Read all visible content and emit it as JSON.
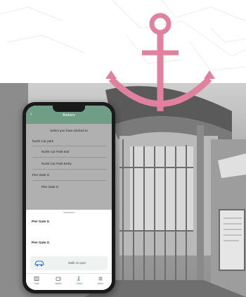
{
  "app": {
    "header_title": "Berkers",
    "subtitle": "Select you have docked to",
    "locations": [
      {
        "label": "North Car park",
        "kind": "section"
      },
      {
        "label": "North Car Park Exit",
        "kind": "sub"
      },
      {
        "label": "North Car Park Entry",
        "kind": "sub"
      },
      {
        "label": "Pier Gate G",
        "kind": "section"
      },
      {
        "label": "Pier Gate G",
        "kind": "sub"
      }
    ],
    "sheet": {
      "items": [
        "Pier Gate G",
        "Pier Gate G"
      ],
      "walk_label": "Walk on open"
    },
    "tabs": [
      {
        "label": "Gate",
        "icon": "gate-icon",
        "active": false
      },
      {
        "label": "Wallet",
        "icon": "wallet-icon",
        "active": false
      },
      {
        "label": "Direct",
        "icon": "directions-icon",
        "active": true
      },
      {
        "label": "Menu",
        "icon": "menu-icon",
        "active": false
      }
    ]
  },
  "colors": {
    "anchor": "#e0829f",
    "header": "#6f9d86",
    "accent": "#4e8b6f"
  }
}
